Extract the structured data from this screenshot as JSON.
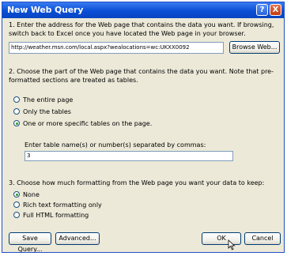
{
  "titlebar": {
    "title": "New Web Query",
    "help_label": "?",
    "close_label": "X"
  },
  "step1": {
    "instruction": "1. Enter the address for the Web page that contains the data you want.  If browsing, switch back to Excel once you have located the Web page in your browser.",
    "address_value": "http://weather.msn.com/local.aspx?wealocations=wc:UKXX0092",
    "browse_label": "Browse Web..."
  },
  "step2": {
    "instruction": "2. Choose the part of the Web page that contains the data you want.  Note that pre-formatted sections are treated as tables.",
    "options": [
      {
        "label": "The entire page",
        "checked": false
      },
      {
        "label": "Only the tables",
        "checked": false
      },
      {
        "label": "One or more specific tables on the page.",
        "checked": true
      }
    ],
    "tables_label": "Enter table name(s) or number(s) separated by commas:",
    "tables_value": "3"
  },
  "step3": {
    "instruction": "3. Choose how much formatting from the Web page you want your data to keep:",
    "options": [
      {
        "label": "None",
        "checked": true
      },
      {
        "label": "Rich text formatting only",
        "checked": false
      },
      {
        "label": "Full HTML formatting",
        "checked": false
      }
    ]
  },
  "buttons": {
    "save_label": "Save Query...",
    "advanced_label": "Advanced...",
    "ok_label": "OK",
    "cancel_label": "Cancel"
  }
}
